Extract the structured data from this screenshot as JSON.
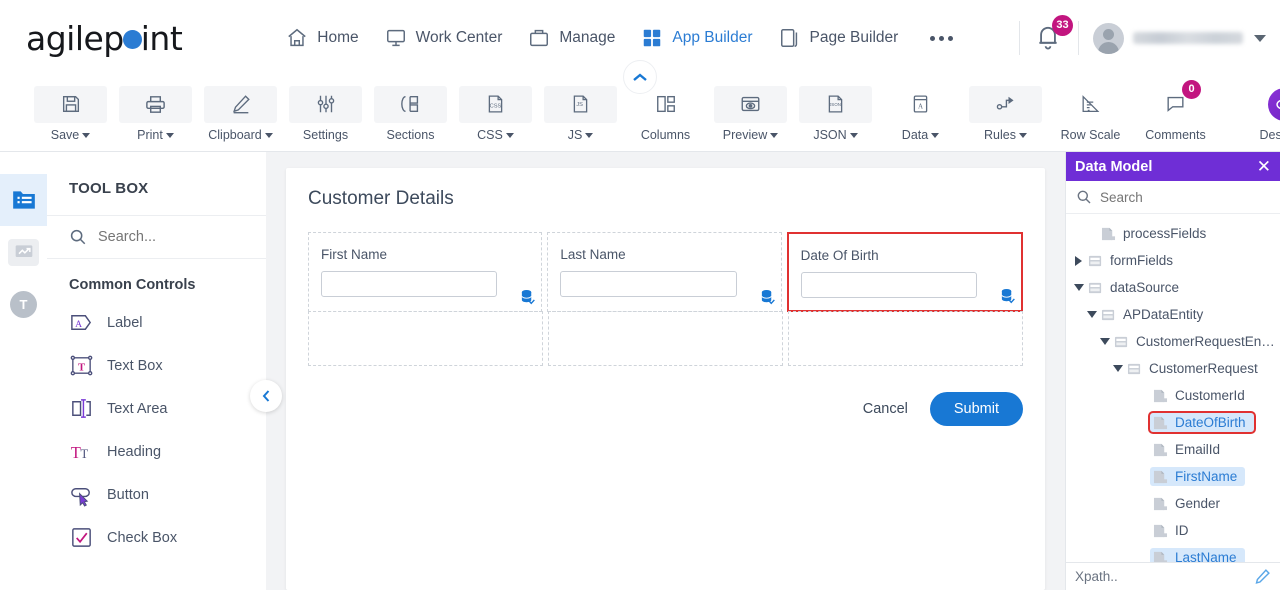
{
  "brand": {
    "name_part1": "agilep",
    "name_part2": "int",
    "accent": "#2b7cd3"
  },
  "nav": {
    "items": [
      {
        "label": "Home",
        "icon": "home-icon",
        "active": false
      },
      {
        "label": "Work Center",
        "icon": "monitor-icon",
        "active": false
      },
      {
        "label": "Manage",
        "icon": "briefcase-icon",
        "active": false
      },
      {
        "label": "App Builder",
        "icon": "grid-icon",
        "active": true
      },
      {
        "label": "Page Builder",
        "icon": "pages-icon",
        "active": false
      }
    ],
    "overflow": "…"
  },
  "header_right": {
    "notification_count": "33",
    "notification_badge_color": "#c2157f",
    "username": ""
  },
  "toolbar": {
    "items": [
      {
        "label": "Save",
        "icon": "save-icon",
        "caret": true
      },
      {
        "label": "Print",
        "icon": "printer-icon",
        "caret": true
      },
      {
        "label": "Clipboard",
        "icon": "pencil-icon",
        "caret": true
      },
      {
        "label": "Settings",
        "icon": "sliders-icon",
        "caret": false
      },
      {
        "label": "Sections",
        "icon": "sections-icon",
        "caret": false
      },
      {
        "label": "CSS",
        "icon": "css-file-icon",
        "caret": true
      },
      {
        "label": "JS",
        "icon": "js-file-icon",
        "caret": true
      },
      {
        "label": "Columns",
        "icon": "columns-icon",
        "caret": false
      },
      {
        "label": "Preview",
        "icon": "eye-window-icon",
        "caret": true
      },
      {
        "label": "JSON",
        "icon": "json-file-icon",
        "caret": true
      },
      {
        "label": "Data",
        "icon": "data-book-icon",
        "caret": true
      },
      {
        "label": "Rules",
        "icon": "rules-flow-icon",
        "caret": true
      },
      {
        "label": "Row Scale",
        "icon": "ruler-icon",
        "caret": false
      },
      {
        "label": "Comments",
        "icon": "comment-icon",
        "caret": false,
        "badge": "0"
      }
    ],
    "design": {
      "label": "Design",
      "icon": "eye-icon",
      "caret": true,
      "color": "#7a2bd0"
    }
  },
  "rail": {
    "items": [
      {
        "icon": "folder-list-icon",
        "active": true
      },
      {
        "icon": "chart-monitor-icon",
        "active": false
      },
      {
        "icon": "text-t-icon",
        "active": false
      }
    ]
  },
  "toolbox": {
    "title": "TOOL BOX",
    "search_placeholder": "Search...",
    "group_label": "Common Controls",
    "items": [
      {
        "label": "Label",
        "icon": "label-tag-icon"
      },
      {
        "label": "Text Box",
        "icon": "textbox-icon"
      },
      {
        "label": "Text Area",
        "icon": "textarea-icon"
      },
      {
        "label": "Heading",
        "icon": "heading-icon"
      },
      {
        "label": "Button",
        "icon": "button-cursor-icon"
      },
      {
        "label": "Check Box",
        "icon": "checkbox-icon"
      }
    ]
  },
  "form": {
    "title": "Customer Details",
    "fields": [
      {
        "label": "First Name",
        "value": "",
        "binding_icon": "database-bound-icon",
        "highlighted": false
      },
      {
        "label": "Last Name",
        "value": "",
        "binding_icon": "database-bound-icon",
        "highlighted": false
      },
      {
        "label": "Date Of Birth",
        "value": "",
        "binding_icon": "database-bound-icon",
        "highlighted": true
      }
    ],
    "empty_cells": 3,
    "cancel_label": "Cancel",
    "submit_label": "Submit",
    "highlight_color": "#e03131",
    "submit_color": "#1878d4"
  },
  "data_model": {
    "title": "Data Model",
    "header_color": "#6f2ed6",
    "search_placeholder": "Search",
    "close_icon": "close-icon",
    "tree": [
      {
        "label": "processFields",
        "depth": 1,
        "toggle": "none",
        "state": "plain"
      },
      {
        "label": "formFields",
        "depth": 0,
        "toggle": "collapsed",
        "state": "plain"
      },
      {
        "label": "dataSource",
        "depth": 0,
        "toggle": "expanded",
        "state": "plain"
      },
      {
        "label": "APDataEntity",
        "depth": 1,
        "toggle": "expanded",
        "state": "plain"
      },
      {
        "label": "CustomerRequestEn…",
        "depth": 2,
        "toggle": "expanded",
        "state": "plain"
      },
      {
        "label": "CustomerRequest",
        "depth": 3,
        "toggle": "expanded",
        "state": "plain"
      },
      {
        "label": "CustomerId",
        "depth": 5,
        "toggle": "none",
        "state": "plain"
      },
      {
        "label": "DateOfBirth",
        "depth": 5,
        "toggle": "none",
        "state": "boxed"
      },
      {
        "label": "EmailId",
        "depth": 5,
        "toggle": "none",
        "state": "plain"
      },
      {
        "label": "FirstName",
        "depth": 5,
        "toggle": "none",
        "state": "selected"
      },
      {
        "label": "Gender",
        "depth": 5,
        "toggle": "none",
        "state": "plain"
      },
      {
        "label": "ID",
        "depth": 5,
        "toggle": "none",
        "state": "plain"
      },
      {
        "label": "LastName",
        "depth": 5,
        "toggle": "none",
        "state": "selected"
      }
    ],
    "footer_label": "Xpath..",
    "footer_icon": "pencil-edit-icon"
  }
}
